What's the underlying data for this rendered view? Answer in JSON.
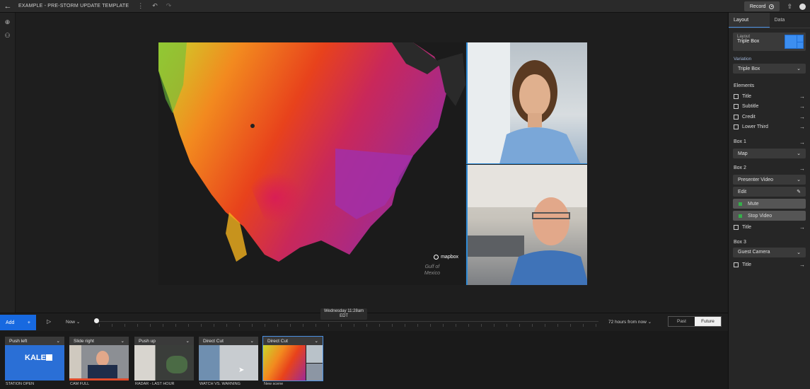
{
  "topbar": {
    "back_icon": "arrow-left-icon",
    "title": "EXAMPLE - PRE-STORM UPDATE TEMPLATE",
    "more_icon": "more-vertical-icon",
    "undo_icon": "undo-icon",
    "redo_icon": "redo-icon",
    "record_label": "Record",
    "upload_icon": "upload-icon",
    "user_icon": "user-icon"
  },
  "left_tools": [
    "globe-icon",
    "people-icon"
  ],
  "stage": {
    "map_brand": "mapbox",
    "map_water_label_1": "Gulf of",
    "map_water_label_2": "Mexico"
  },
  "panel": {
    "tabs": [
      "Layout",
      "Data"
    ],
    "layout_label": "Layout",
    "layout_value": "Triple Box",
    "variation_label": "Variation",
    "variation_value": "Triple Box",
    "elements_label": "Elements",
    "elements": [
      "Title",
      "Subtitle",
      "Credit",
      "Lower Third"
    ],
    "box1": {
      "label": "Box 1",
      "value": "Map"
    },
    "box2": {
      "label": "Box 2",
      "value": "Presenter Video",
      "edit": "Edit",
      "mute": "Mute",
      "stop": "Stop Video",
      "title": "Title"
    },
    "box3": {
      "label": "Box 3",
      "value": "Guest Camera",
      "title": "Title"
    },
    "colors": {
      "accent": "#1769e0",
      "green": "#35b04a"
    }
  },
  "timeline": {
    "add_label": "Add",
    "add_plus": "+",
    "play_icon": "play-icon",
    "now_label": "Now",
    "time_line1": "Wednesday 11:28am",
    "time_line2": "EDT",
    "hours_label": "72 hours from now",
    "past_label": "Past",
    "future_label": "Future"
  },
  "scenes": [
    {
      "transition": "Push left",
      "caption": "STATION OPEN",
      "logo": "KALE"
    },
    {
      "transition": "Slide right",
      "caption": "CAM FULL"
    },
    {
      "transition": "Push up",
      "caption": "RADAR - LAST HOUR"
    },
    {
      "transition": "Direct Cut",
      "caption": "WATCH VS. WARNING"
    },
    {
      "transition": "Direct Cut",
      "caption": "New scene"
    }
  ]
}
